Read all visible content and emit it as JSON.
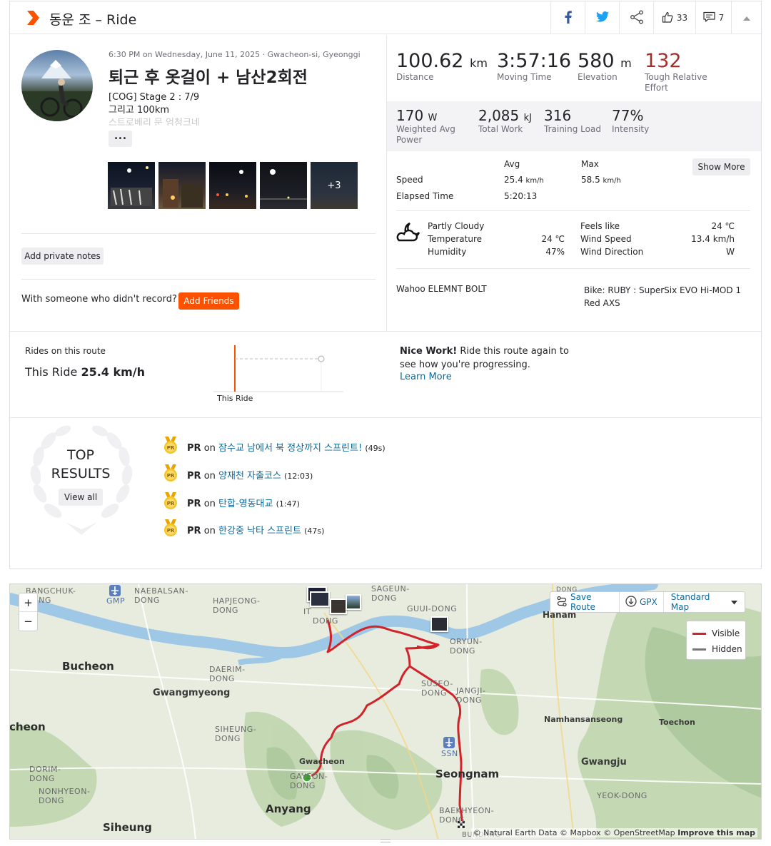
{
  "header": {
    "title": "동운 조 – Ride",
    "kudos_count": "33",
    "comment_count": "7"
  },
  "activity": {
    "date_line": "6:30 PM on Wednesday, June 11, 2025 · Gwacheon-si, Gyeonggi",
    "name": "퇴근 후 옷걸이 + 남산2회전",
    "desc_line1": "[COG] Stage 2 : 7/9",
    "desc_line2": "그리고 100km",
    "desc_line3": "스트로베리 문 엄청크네",
    "more_label": "•••",
    "photo_more": "+3",
    "private_notes_label": "Add private notes",
    "with_someone": "With someone who didn't record?",
    "add_friends_label": "Add Friends"
  },
  "stats_main": [
    {
      "value": "100.62",
      "unit": "km",
      "label": "Distance"
    },
    {
      "value": "3:57:16",
      "unit": "",
      "label": "Moving Time"
    },
    {
      "value": "580",
      "unit": "m",
      "label": "Elevation"
    },
    {
      "value": "132",
      "unit": "",
      "label": "Tough Relative Effort"
    }
  ],
  "stats_secondary": [
    {
      "value": "170",
      "unit": "W",
      "label": "Weighted Avg Power"
    },
    {
      "value": "2,085",
      "unit": "kJ",
      "label": "Total Work"
    },
    {
      "value": "316",
      "unit": "",
      "label": "Training Load"
    },
    {
      "value": "77%",
      "unit": "",
      "label": "Intensity"
    }
  ],
  "table": {
    "col_avg": "Avg",
    "col_max": "Max",
    "show_more": "Show More",
    "rows": [
      {
        "label": "Speed",
        "avg": "25.4",
        "avg_unit": "km/h",
        "max": "58.5",
        "max_unit": "km/h"
      },
      {
        "label": "Elapsed Time",
        "avg": "5:20:13",
        "avg_unit": "",
        "max": "",
        "max_unit": ""
      }
    ]
  },
  "weather": {
    "condition": "Partly Cloudy",
    "temp_label": "Temperature",
    "temp_value": "24 ℃",
    "humidity_label": "Humidity",
    "humidity_value": "47%",
    "feels_label": "Feels like",
    "feels_value": "24 ℃",
    "wind_speed_label": "Wind Speed",
    "wind_speed_value": "13.4 km/h",
    "wind_dir_label": "Wind Direction",
    "wind_dir_value": "W"
  },
  "device": {
    "device_name": "Wahoo ELEMNT BOLT",
    "bike": "Bike: RUBY : SuperSix EVO Hi-MOD 1 Red AXS"
  },
  "route": {
    "rides_label": "Rides on this route",
    "this_ride_prefix": "This Ride",
    "this_ride_speed": "25.4 km/h",
    "chart_label": "This Ride",
    "nice_bold": "Nice Work!",
    "nice_text": "Ride this route again to see how you're progressing.",
    "learn_more": "Learn More"
  },
  "top_results": {
    "title_line1": "TOP",
    "title_line2": "RESULTS",
    "view_all": "View all",
    "items": [
      {
        "badge": "PR",
        "prefix": "PR",
        "on": "on",
        "segment": "잠수교 남에서 북 정상까지 스프린트!",
        "time": "(49s)"
      },
      {
        "badge": "PR",
        "prefix": "PR",
        "on": "on",
        "segment": "양재천 자출코스",
        "time": "(12:03)"
      },
      {
        "badge": "PR",
        "prefix": "PR",
        "on": "on",
        "segment": "탄합-영동대교",
        "time": "(1:47)"
      },
      {
        "badge": "PR",
        "prefix": "PR",
        "on": "on",
        "segment": "한강중 낙타 스프린트",
        "time": "(47s)"
      }
    ]
  },
  "map": {
    "zoom_in": "+",
    "zoom_out": "−",
    "save_route": "Save Route",
    "gpx": "GPX",
    "map_type": "Standard Map",
    "legend_visible": "Visible",
    "legend_hidden": "Hidden",
    "attribution": "© Natural Earth Data © Mapbox © OpenStreetMap",
    "improve": "Improve this map",
    "labels": {
      "bangchuk": "BANGCHUK-DONG",
      "gmp": "GMP",
      "naebalsan": "NAEBALSAN-DONG",
      "hapjeong": "HAPJEONG-DONG",
      "itaewon": "IT",
      "dong1": "DONG",
      "sageun": "SAGEUN-DONG",
      "guui": "GUUI-DONG",
      "dong_top": "DONG",
      "hanam": "Hanam",
      "oryun": "ORYUN-DONG",
      "bucheon": "Bucheon",
      "gwangmyeong": "Gwangmyeong",
      "daerim": "DAERIM-DONG",
      "susec": "SUSEO-DONG",
      "jangji": "JANGJI-DONG",
      "namhansanseong": "Namhansanseong",
      "toechon": "Toechon",
      "incheon": "cheon",
      "siheung_dong": "SIHEUNG-DONG",
      "ssn": "SSN",
      "gwacheon": "Gwacheon",
      "gayeon": "GAYEON-DONG",
      "seongnam": "Seongnam",
      "gwangju": "Gwangju",
      "dorim": "DORIM-DONG",
      "nonhyeon": "NONHYEON-DONG",
      "yeokdong": "YEOK-DONG",
      "anyang": "Anyang",
      "baekhyeon": "BAEKHYEON-DONG",
      "siheung": "Siheung",
      "bundang": "BUNDANG"
    }
  },
  "colors": {
    "accent": "#fc5200",
    "effort_red": "#a1302b",
    "route_red": "#d2232a",
    "link": "#0a6a9e",
    "pr_gold": "#f3c627"
  },
  "icons": [
    "strava-chevron-icon",
    "facebook-icon",
    "twitter-icon",
    "share-icon",
    "kudos-thumb-icon",
    "comment-icon",
    "caret-up-icon",
    "weather-cloud-moon-icon",
    "pr-medal-icon",
    "laurel-icon",
    "save-route-icon",
    "gpx-download-icon",
    "dropdown-caret-icon",
    "airport-icon"
  ]
}
